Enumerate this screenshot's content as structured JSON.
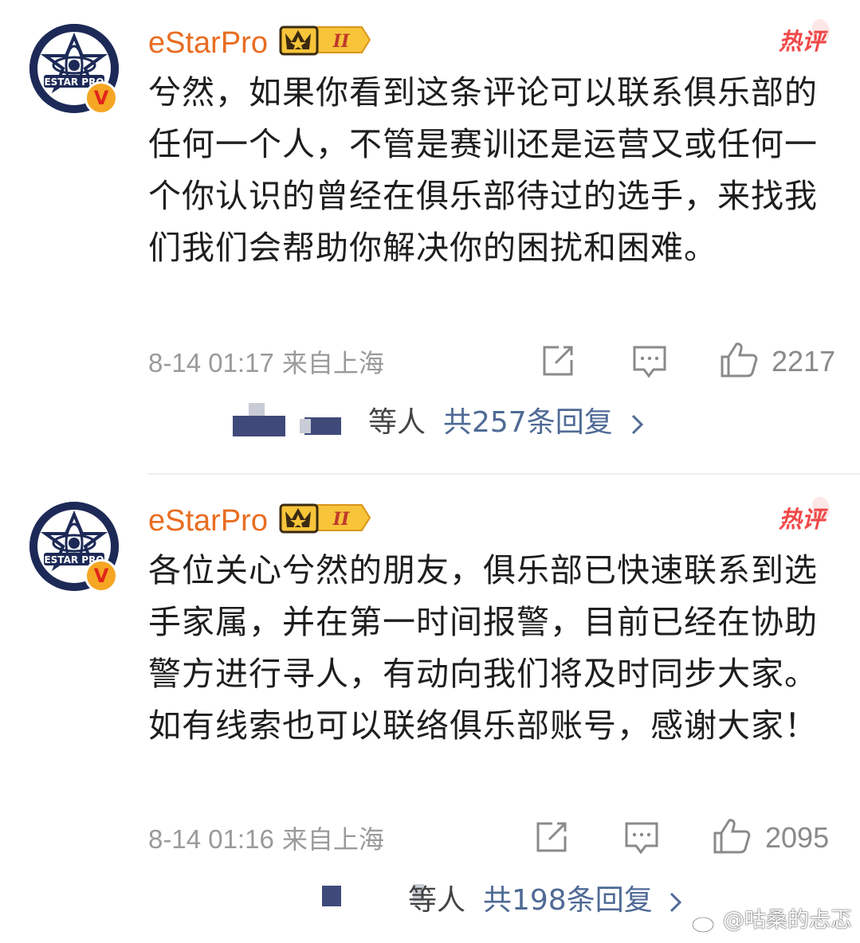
{
  "comments": [
    {
      "username": "eStarPro",
      "avatar_text": "ESTAR PRO",
      "verified_mark": "V",
      "level": "II",
      "hot_label": "热评",
      "text": "兮然，如果你看到这条评论可以联系俱乐部的任何一个人，不管是赛训还是运营又或任何一个你认识的曾经在俱乐部待过的选手，来找我们我们会帮助你解决你的困扰和困难。",
      "time": "8-14 01:17",
      "location": "来自上海",
      "likes": "2217",
      "reply_people": "等人",
      "reply_total": "共257条回复"
    },
    {
      "username": "eStarPro",
      "avatar_text": "ESTAR PRO",
      "verified_mark": "V",
      "level": "II",
      "hot_label": "热评",
      "text": "各位关心兮然的朋友，俱乐部已快速联系到选手家属，并在第一时间报警，目前已经在协助警方进行寻人，有动向我们将及时同步大家。如有线索也可以联络俱乐部账号，感谢大家！",
      "time": "8-14 01:16",
      "location": "来自上海",
      "likes": "2095",
      "reply_people": "等人",
      "reply_total": "共198条回复"
    }
  ],
  "watermark": "@咕桑的忐忑",
  "colors": {
    "username": "#e96d21",
    "hot": "#f04848",
    "link": "#4f6a95",
    "meta": "#9a9a9a"
  },
  "icons": [
    "share-icon",
    "comment-icon",
    "like-icon",
    "chevron-right-icon",
    "weibo-icon"
  ]
}
